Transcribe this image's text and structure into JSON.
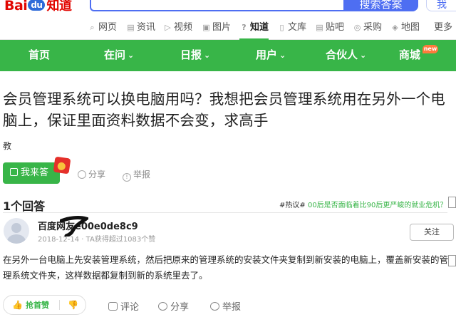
{
  "header": {
    "logo_text": "Bai",
    "logo_paw": "du",
    "logo_zhidao": "知道",
    "search_button": "搜索答案",
    "extra_button": "我",
    "categories": [
      {
        "icon": "⌕",
        "label": "网页"
      },
      {
        "icon": "▤",
        "label": "资讯"
      },
      {
        "icon": "▷",
        "label": "视频"
      },
      {
        "icon": "▣",
        "label": "图片"
      },
      {
        "icon": "?",
        "label": "知道"
      },
      {
        "icon": "▯",
        "label": "文库"
      },
      {
        "icon": "▤",
        "label": "贴吧"
      },
      {
        "icon": "◎",
        "label": "采购"
      },
      {
        "icon": "◈",
        "label": "地图"
      },
      {
        "icon": "",
        "label": "更多"
      }
    ]
  },
  "nav": {
    "items": [
      {
        "label": "首页",
        "chevron": ""
      },
      {
        "label": "在问",
        "chevron": "⌄"
      },
      {
        "label": "日报",
        "chevron": "⌄"
      },
      {
        "label": "用户",
        "chevron": "⌄"
      },
      {
        "label": "合伙人",
        "chevron": "⌄"
      },
      {
        "label": "商城",
        "chevron": ""
      }
    ],
    "new_badge": "new"
  },
  "question": {
    "title": "会员管理系统可以换电脑用吗？我想把会员管理系统用在另外一个电脑上，保证里面资料数据不会变，求高手",
    "tag": "教",
    "answer_button": "我来答",
    "share": "分享",
    "report": "举报"
  },
  "answers": {
    "count_label": "1个回答",
    "hot_prefix": "#热议#",
    "hot_link": "00后是否面临着比90后更严峻的就业危机？",
    "answerer_name": "百度网友e00e0de8c9",
    "answerer_meta": "2018-12-14 · TA获得超过1083个赞",
    "follow_button": "关注",
    "text": "在另外一台电脑上先安装管理系统，然后把原来的管理系统的安装文件夹复制到新安装的电脑上，覆盖新安装的管理系统文件夹，这样数据都复制到新的系统里去了。",
    "like_button": "抢首赞",
    "comment": "评论",
    "share": "分享",
    "report": "举报"
  },
  "colors": {
    "accent": "#38b548",
    "baidu_blue": "#4e6ef2",
    "baidu_red": "#e10601"
  }
}
